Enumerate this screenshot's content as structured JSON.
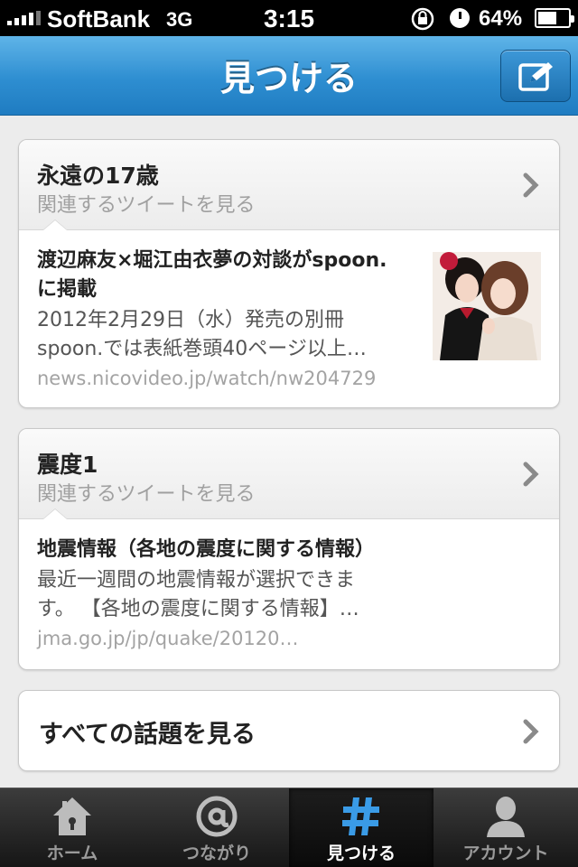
{
  "status_bar": {
    "carrier": "SoftBank",
    "network": "3G",
    "time": "3:15",
    "battery": "64%"
  },
  "nav": {
    "title": "見つける",
    "compose_icon": "compose-icon"
  },
  "topics": [
    {
      "title": "永遠の17歳",
      "subtitle": "関連するツイートを見る",
      "story": {
        "title_lines": [
          "渡辺麻友×堀江由衣夢の対談がspoon.",
          "に掲載"
        ],
        "desc_lines": [
          "2012年2月29日（水）発売の別冊",
          "spoon.では表紙巻頭40ページ以上…"
        ],
        "url": "news.nicovideo.jp/watch/nw204729"
      }
    },
    {
      "title": "震度1",
      "subtitle": "関連するツイートを見る",
      "story": {
        "title_lines": [
          "地震情報（各地の震度に関する情報）"
        ],
        "desc_lines": [
          "最近一週間の地震情報が選択できま",
          "す。 【各地の震度に関する情報】…"
        ],
        "url": "jma.go.jp/jp/quake/20120…"
      }
    }
  ],
  "all_topics_label": "すべての話題を見る",
  "tabs": [
    {
      "label": "ホーム",
      "icon": "home-icon",
      "active": false
    },
    {
      "label": "つながり",
      "icon": "at-icon",
      "active": false
    },
    {
      "label": "見つける",
      "icon": "hashtag-icon",
      "active": true
    },
    {
      "label": "アカウント",
      "icon": "person-icon",
      "active": false
    }
  ],
  "colors": {
    "nav_blue": "#2e8ed1",
    "active_tab_icon": "#3a9be6"
  }
}
